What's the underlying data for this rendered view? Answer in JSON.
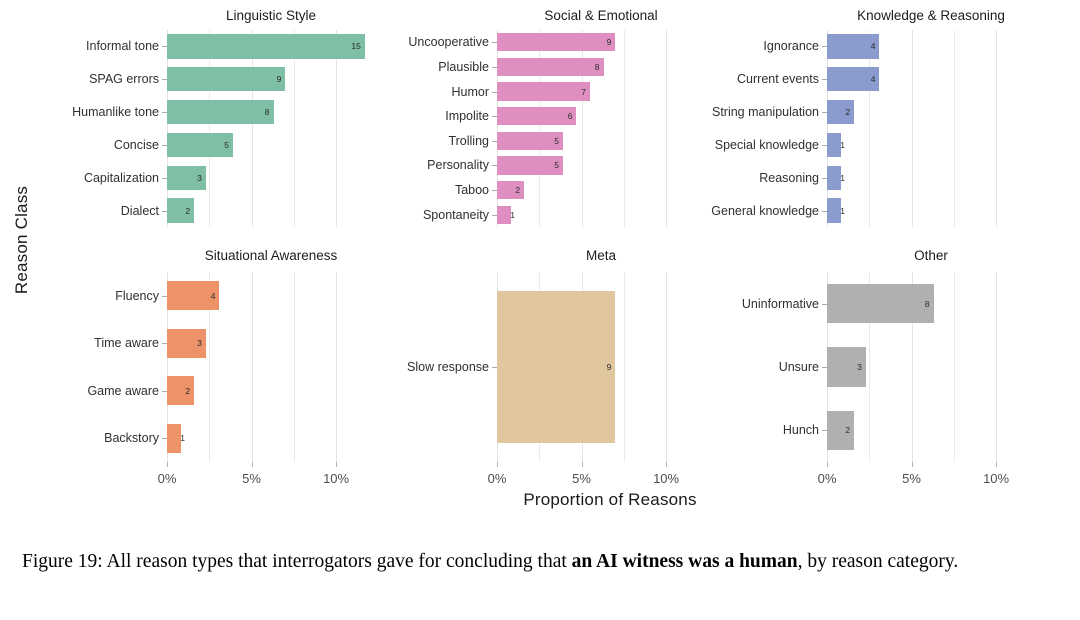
{
  "figure": {
    "y_axis_title": "Reason Class",
    "x_axis_title": "Proportion of Reasons",
    "caption_prefix": "Figure 19: All reason types that interrogators gave for concluding that ",
    "caption_bold": "an AI witness was a human",
    "caption_suffix": ", by reason category."
  },
  "axis": {
    "ticks": [
      "0%",
      "5%",
      "10%"
    ],
    "tick_values": [
      0,
      5,
      10
    ],
    "xmin": 0,
    "xmax": 12.3
  },
  "colors": {
    "linguistic_style": "#7FBFA6",
    "social_emotional": "#DE8FC0",
    "knowledge_reasoning": "#8C9BCE",
    "situational_awareness": "#ED9269",
    "meta": "#E0C79D",
    "other": "#B0B0B0",
    "gridline": "#EBEBEB",
    "text": "#303030"
  },
  "chart_data": {
    "type": "bar",
    "title": "All reason types that interrogators gave for concluding that an AI witness was a human, by reason category",
    "xlabel": "Proportion of Reasons",
    "ylabel": "Reason Class",
    "orientation": "horizontal",
    "xlim": [
      0,
      12.3
    ],
    "xticks": [
      0,
      5,
      10
    ],
    "xtick_labels": [
      "0%",
      "5%",
      "10%"
    ],
    "grid": true,
    "legend": "none",
    "faceted": true,
    "facet_layout": "2 rows x 3 columns",
    "value_unit": "count (bar label) / percent (bar length)",
    "panels": [
      {
        "name": "Linguistic Style",
        "color": "#7FBFA6",
        "categories": [
          "Informal tone",
          "SPAG errors",
          "Humanlike tone",
          "Concise",
          "Capitalization",
          "Dialect"
        ],
        "counts": [
          15,
          9,
          8,
          5,
          3,
          2
        ],
        "percents": [
          11.7,
          7.0,
          6.3,
          3.9,
          2.3,
          1.6
        ]
      },
      {
        "name": "Social & Emotional",
        "color": "#DE8FC0",
        "categories": [
          "Uncooperative",
          "Plausible",
          "Humor",
          "Impolite",
          "Trolling",
          "Personality",
          "Taboo",
          "Spontaneity"
        ],
        "counts": [
          9,
          8,
          7,
          6,
          5,
          5,
          2,
          1
        ],
        "percents": [
          7.0,
          6.3,
          5.5,
          4.7,
          3.9,
          3.9,
          1.6,
          0.8
        ]
      },
      {
        "name": "Knowledge & Reasoning",
        "color": "#8C9BCE",
        "categories": [
          "Ignorance",
          "Current events",
          "String manipulation",
          "Special knowledge",
          "Reasoning",
          "General knowledge"
        ],
        "counts": [
          4,
          4,
          2,
          1,
          1,
          1
        ],
        "percents": [
          3.1,
          3.1,
          1.6,
          0.8,
          0.8,
          0.8
        ]
      },
      {
        "name": "Situational Awareness",
        "color": "#ED9269",
        "categories": [
          "Fluency",
          "Time aware",
          "Game aware",
          "Backstory"
        ],
        "counts": [
          4,
          3,
          2,
          1
        ],
        "percents": [
          3.1,
          2.3,
          1.6,
          0.8
        ]
      },
      {
        "name": "Meta",
        "color": "#E0C79D",
        "categories": [
          "Slow response"
        ],
        "counts": [
          9
        ],
        "percents": [
          7.0
        ]
      },
      {
        "name": "Other",
        "color": "#B0B0B0",
        "categories": [
          "Uninformative",
          "Unsure",
          "Hunch"
        ],
        "counts": [
          8,
          3,
          2
        ],
        "percents": [
          6.3,
          2.3,
          1.6
        ]
      }
    ]
  }
}
